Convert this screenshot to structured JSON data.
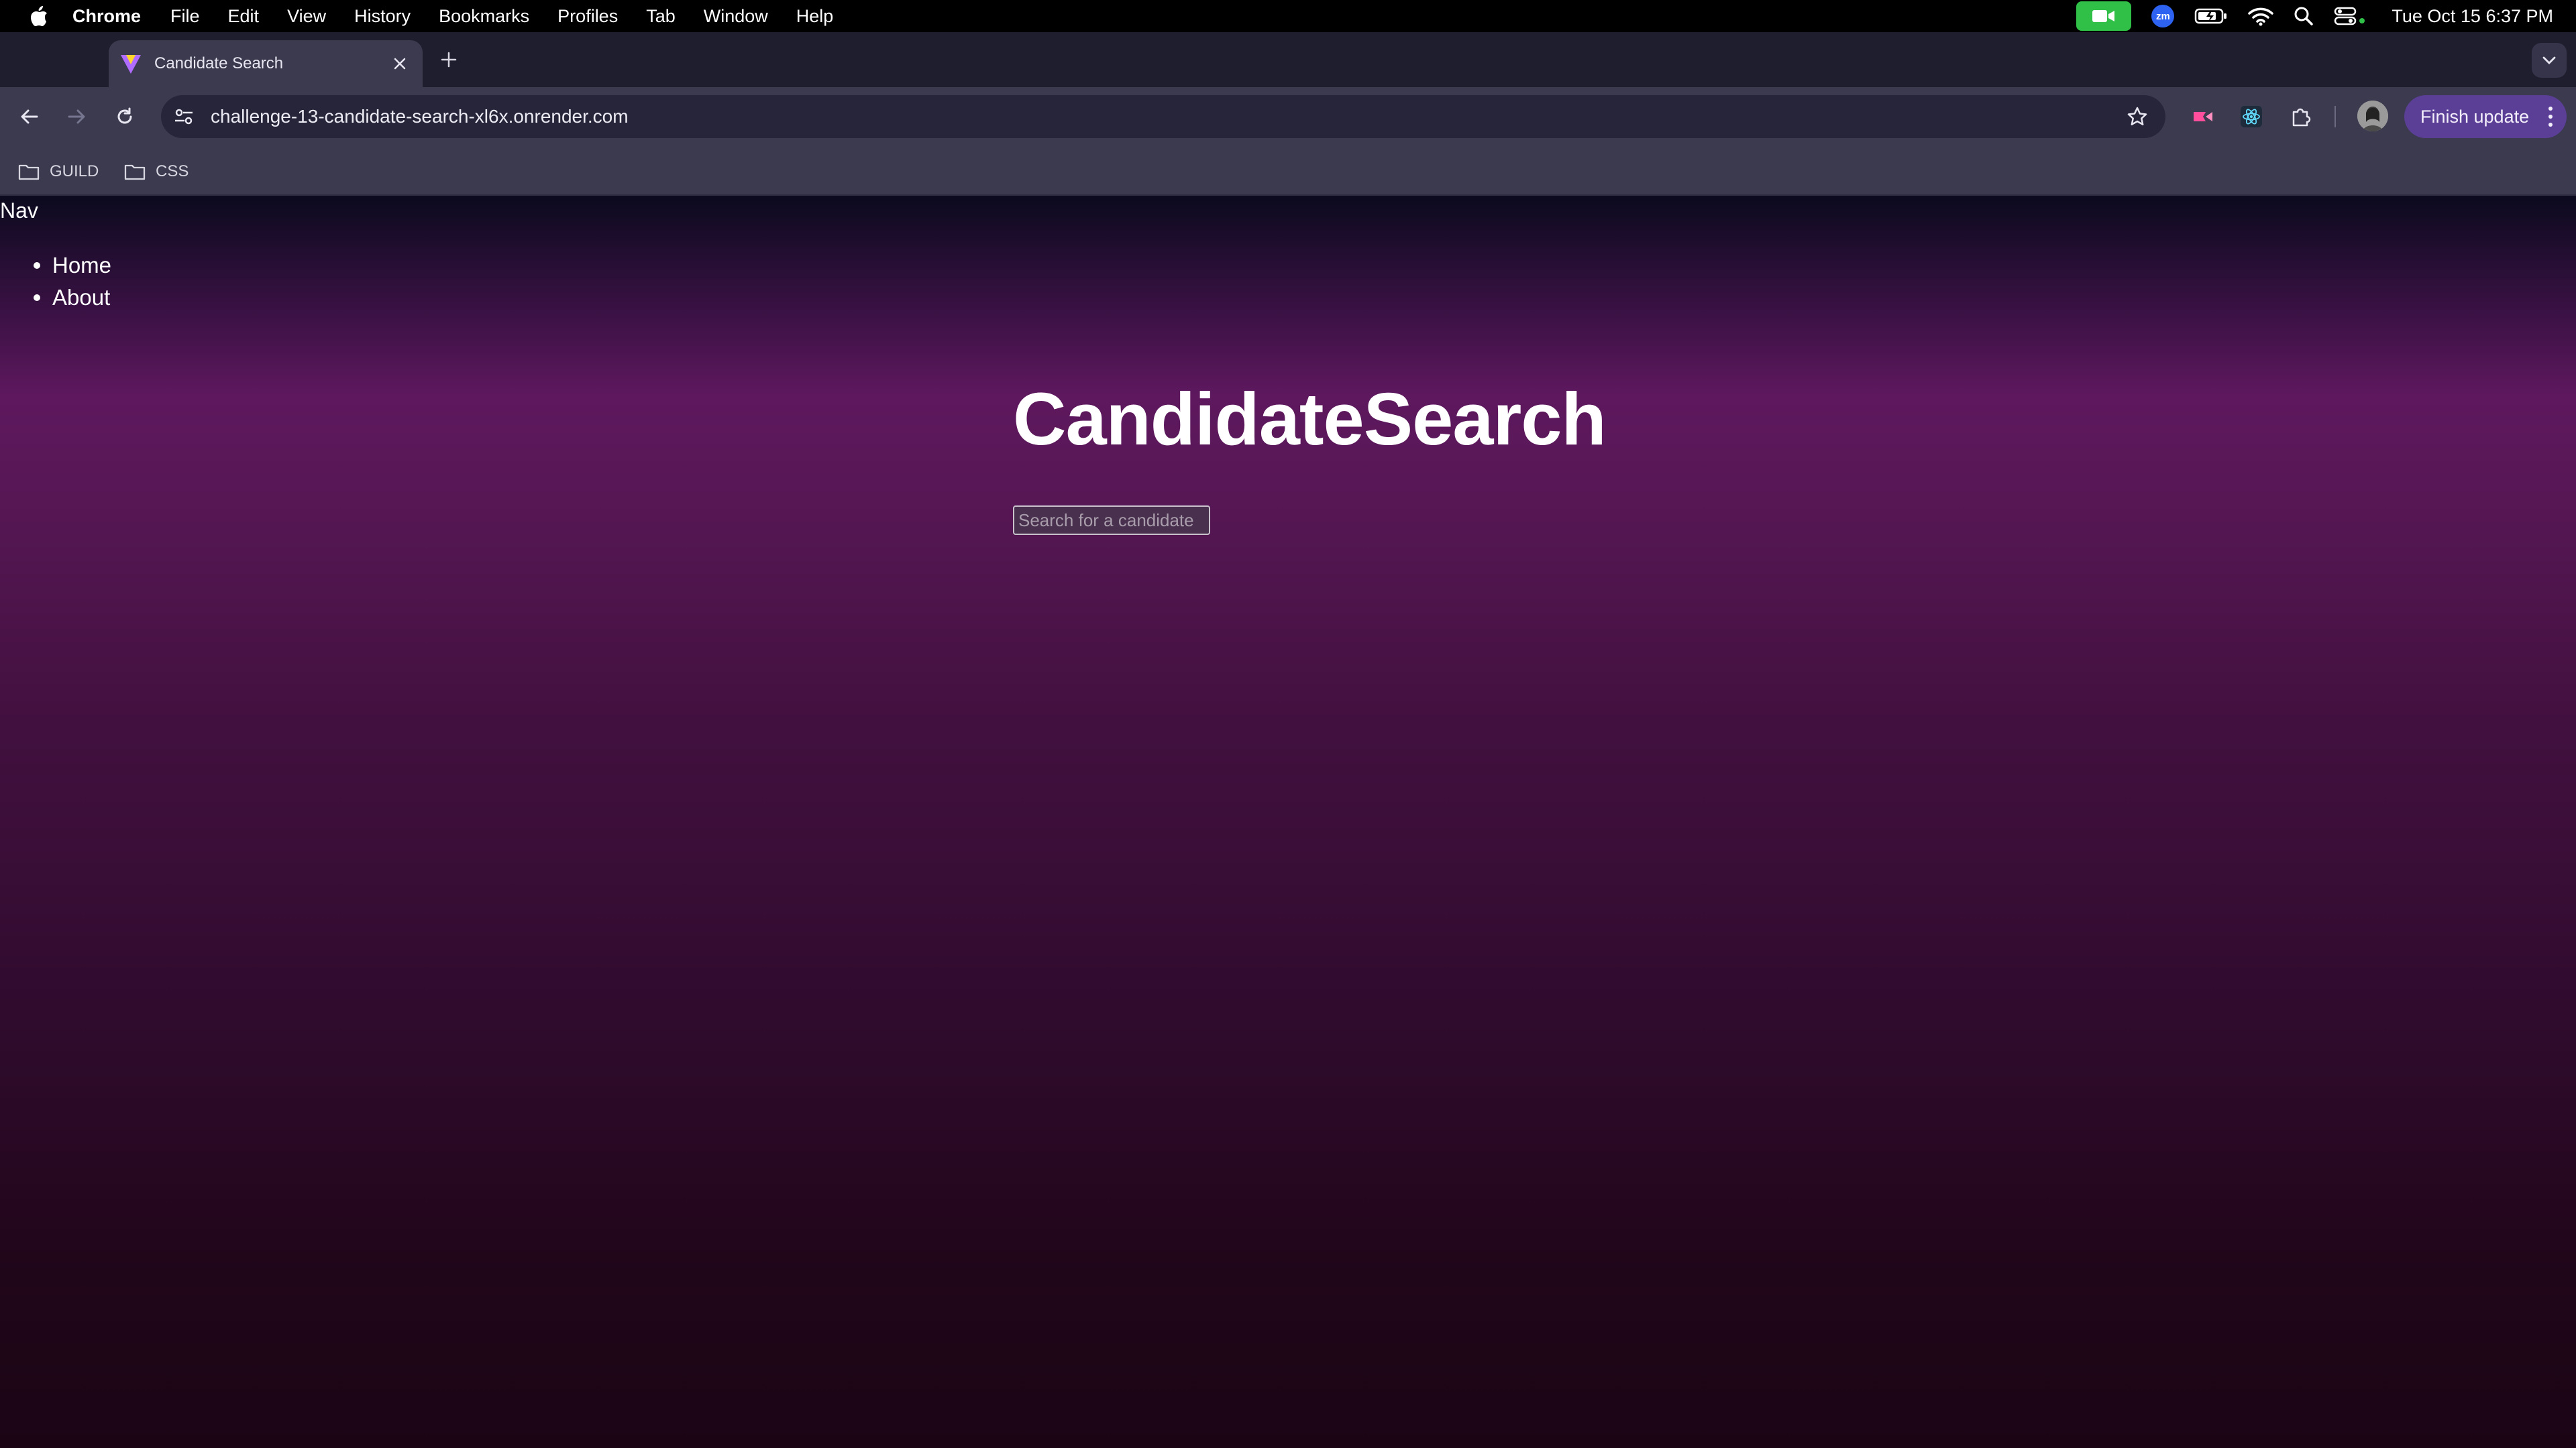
{
  "menubar": {
    "app_name": "Chrome",
    "items": [
      "File",
      "Edit",
      "View",
      "History",
      "Bookmarks",
      "Profiles",
      "Tab",
      "Window",
      "Help"
    ],
    "zoom_label": "zm",
    "clock": "Tue Oct 15  6:37 PM"
  },
  "browser": {
    "tab_title": "Candidate Search",
    "url": "challenge-13-candidate-search-xl6x.onrender.com",
    "update_button": "Finish update",
    "bookmarks": [
      "GUILD",
      "CSS"
    ]
  },
  "page": {
    "nav_heading": "Nav",
    "nav_links": [
      "Home",
      "About"
    ],
    "title": "CandidateSearch",
    "search_placeholder": "Search for a candidate"
  },
  "colors": {
    "update_button": "#5b3f96",
    "facetime": "#30c048",
    "page_gradient_mid": "#5e185e"
  }
}
